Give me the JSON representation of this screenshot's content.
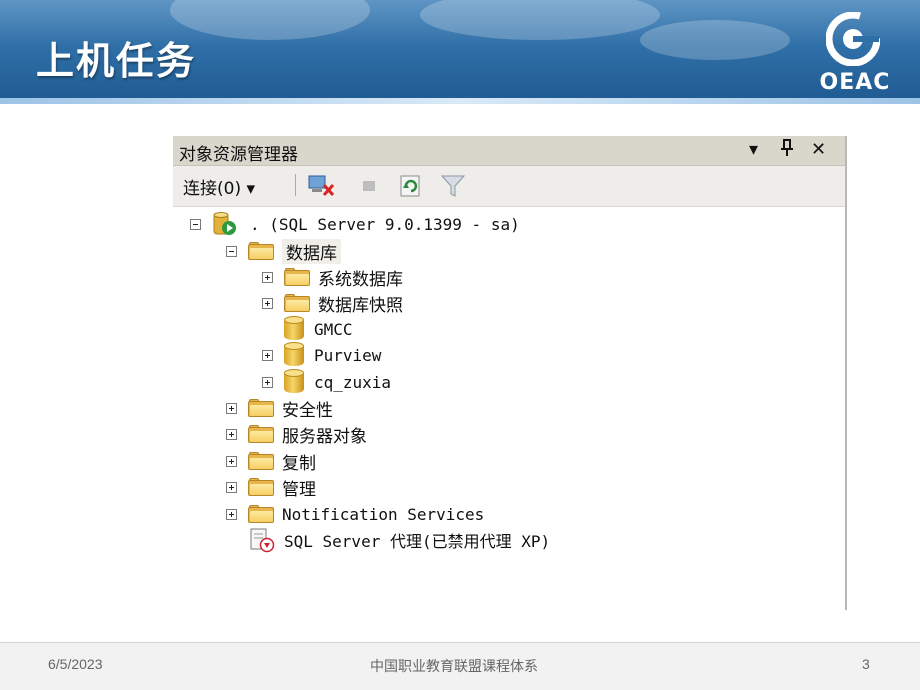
{
  "slide": {
    "title": "上机任务",
    "logo_text": "OEAC",
    "footer_date": "6/5/2023",
    "footer_center": "中国职业教育联盟课程体系",
    "page_number": "3"
  },
  "explorer": {
    "title": "对象资源管理器",
    "controls": {
      "dropdown": "▾",
      "pin": "ᛘ",
      "close": "✕"
    },
    "toolbar": {
      "connect_label": "连接(0)",
      "connect_arrow": "▾",
      "icons": [
        "disconnect-icon",
        "stop-icon",
        "refresh-icon",
        "filter-icon"
      ]
    },
    "tree": [
      {
        "label": ".  (SQL Server 9.0.1399 - sa)",
        "icon": "server-icon",
        "expander": "minus",
        "level": 0
      },
      {
        "label": "数据库",
        "icon": "folder-icon",
        "expander": "minus",
        "level": 1,
        "selected": true
      },
      {
        "label": "系统数据库",
        "icon": "folder-icon",
        "expander": "plus",
        "level": 2
      },
      {
        "label": "数据库快照",
        "icon": "folder-icon",
        "expander": "plus",
        "level": 2
      },
      {
        "label": "GMCC",
        "icon": "database-icon",
        "expander": "none",
        "level": 2
      },
      {
        "label": "Purview",
        "icon": "database-icon",
        "expander": "plus",
        "level": 2
      },
      {
        "label": "cq_zuxia",
        "icon": "database-icon",
        "expander": "plus",
        "level": 2
      },
      {
        "label": "安全性",
        "icon": "folder-icon",
        "expander": "plus",
        "level": 1
      },
      {
        "label": "服务器对象",
        "icon": "folder-icon",
        "expander": "plus",
        "level": 1
      },
      {
        "label": "复制",
        "icon": "folder-icon",
        "expander": "plus",
        "level": 1
      },
      {
        "label": "管理",
        "icon": "folder-icon",
        "expander": "plus",
        "level": 1
      },
      {
        "label": "Notification Services",
        "icon": "folder-icon",
        "expander": "plus",
        "level": 1
      },
      {
        "label": "SQL Server 代理(已禁用代理 XP)",
        "icon": "agent-icon",
        "expander": "none",
        "level": 1
      }
    ]
  }
}
